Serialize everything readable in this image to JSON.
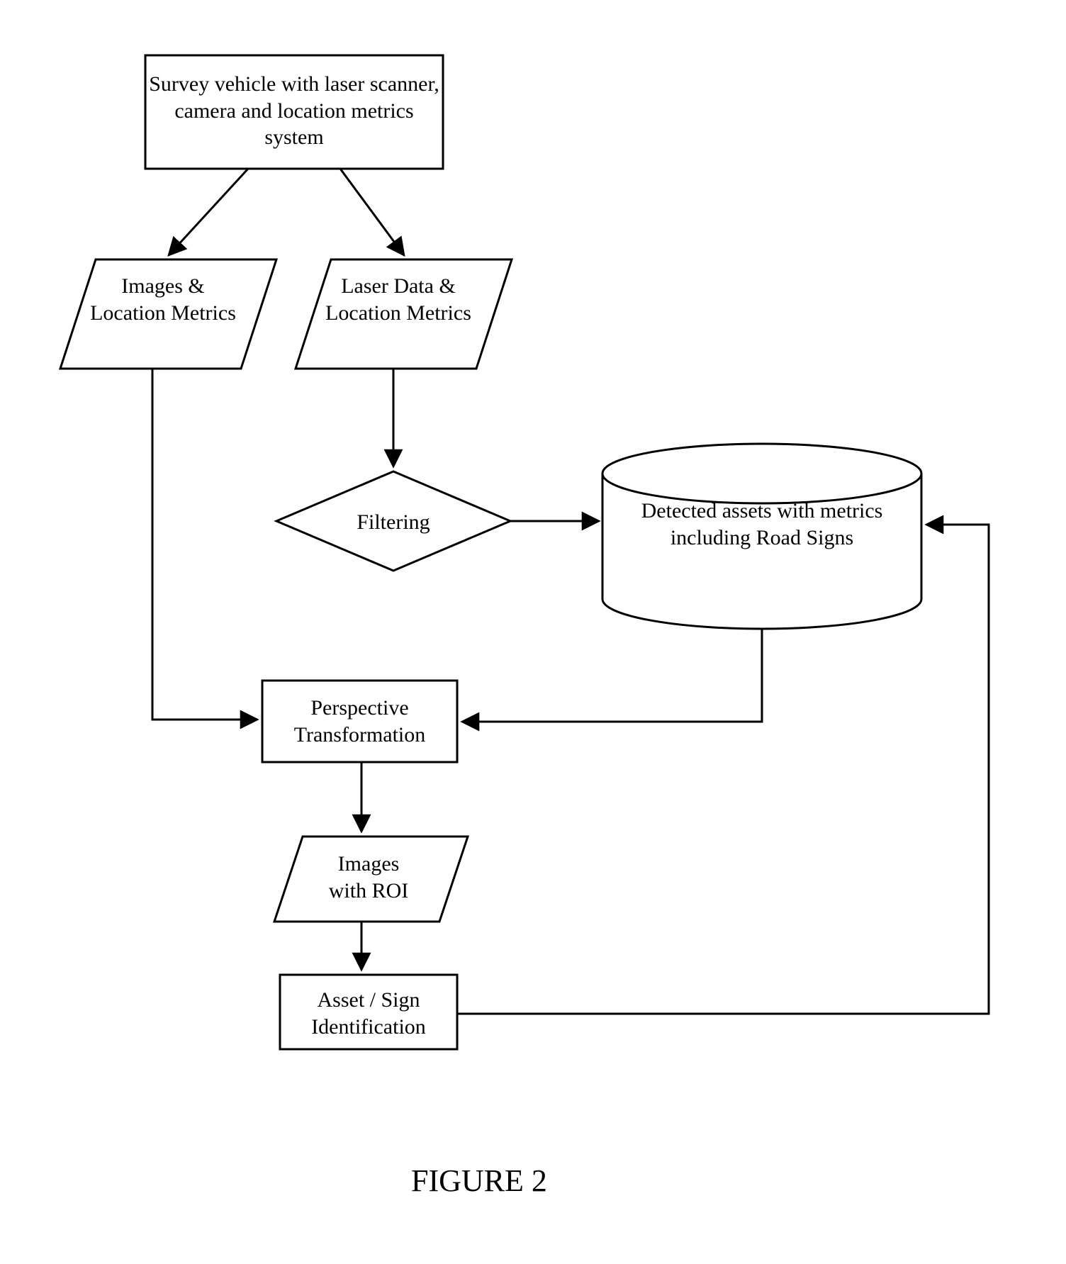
{
  "nodes": {
    "survey": {
      "text": "Survey vehicle with laser scanner, camera and location metrics system"
    },
    "images_loc": {
      "text": "Images & Location Metrics"
    },
    "laser_loc": {
      "text": "Laser Data & Location Metrics"
    },
    "filtering": {
      "text": "Filtering"
    },
    "database": {
      "text": "Detected assets with metrics including Road Signs"
    },
    "perspective": {
      "text": "Perspective Transformation"
    },
    "images_roi": {
      "text": "Images\nwith  ROI"
    },
    "asset_id": {
      "text": "Asset / Sign Identification"
    }
  },
  "caption": "FIGURE 2"
}
